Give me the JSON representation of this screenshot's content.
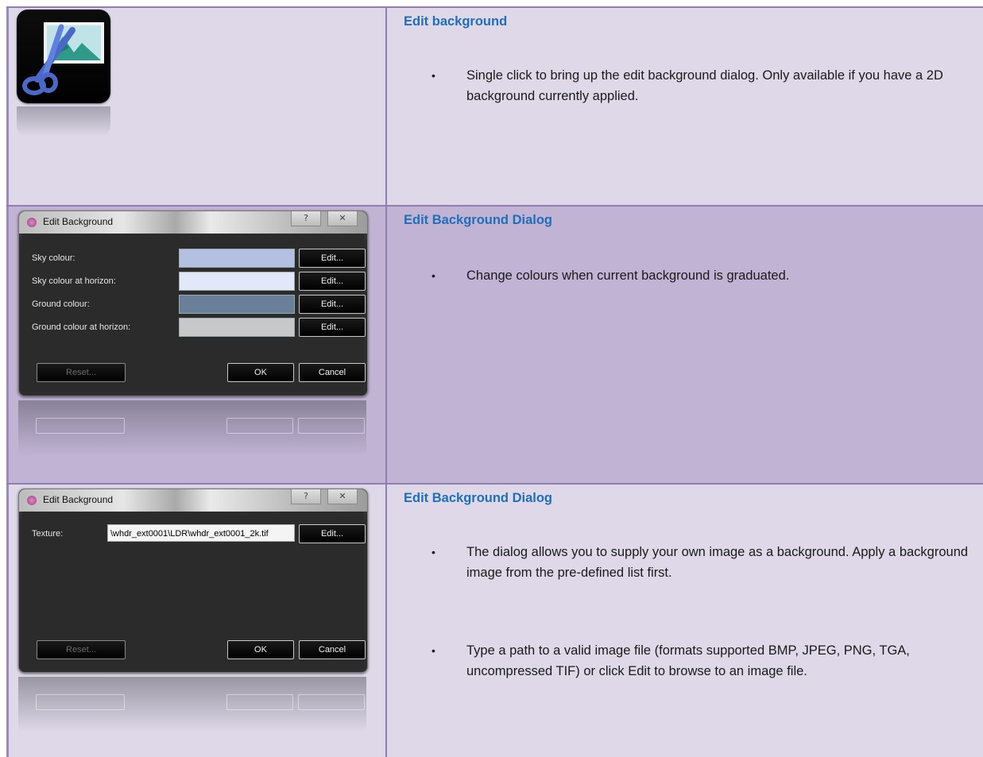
{
  "rows": [
    {
      "heading": "Edit background",
      "bullets": [
        "Single click to bring up the edit background dialog. Only available if you have a 2D background currently applied."
      ]
    },
    {
      "heading": "Edit Background Dialog",
      "bullets": [
        "Change colours when current background is graduated."
      ],
      "dialog": {
        "title": "Edit Background",
        "help": "?",
        "close": "✕",
        "fields": [
          {
            "label": "Sky colour:",
            "color": "#b4c0e2",
            "edit": "Edit..."
          },
          {
            "label": "Sky colour at horizon:",
            "color": "#e2e8fa",
            "edit": "Edit..."
          },
          {
            "label": "Ground colour:",
            "color": "#6a7f98",
            "edit": "Edit..."
          },
          {
            "label": "Ground colour at horizon:",
            "color": "#c8c8c8",
            "edit": "Edit..."
          }
        ],
        "reset": "Reset...",
        "ok": "OK",
        "cancel": "Cancel"
      }
    },
    {
      "heading": "Edit Background Dialog",
      "bullets": [
        "The dialog allows you to supply your own image as a background. Apply a background image from the pre-defined list first.",
        "Type a path to a valid image file (formats supported BMP, JPEG, PNG, TGA, uncompressed TIF) or click Edit to browse to an image file."
      ],
      "dialog": {
        "title": "Edit Background",
        "help": "?",
        "close": "✕",
        "texture_label": "Texture:",
        "texture_value": "\\whdr_ext0001\\LDR\\whdr_ext0001_2k.tif",
        "edit": "Edit...",
        "reset": "Reset...",
        "ok": "OK",
        "cancel": "Cancel"
      }
    }
  ],
  "bullet_char": "•",
  "colors": {
    "heading": "#1f6fb8",
    "row_light": "#ded8e8",
    "row_dark": "#c0b3d4",
    "border": "#8f7fb0"
  },
  "icons": {
    "row1": "edit-background-scissors-icon"
  }
}
